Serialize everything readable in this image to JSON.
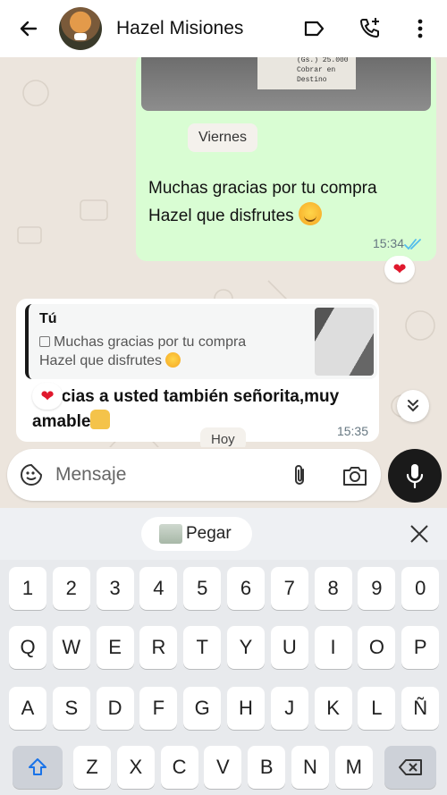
{
  "header": {
    "contact_name": "Hazel Misiones"
  },
  "chat": {
    "date_chip_top": "Viernes",
    "receipt_line1": "(Gs.) 25.000",
    "receipt_line2": "Cobrar en Destino",
    "outgoing": {
      "text_line1": "Muchas gracias por tu compra",
      "text_line2": "Hazel que disfrutes",
      "time": "15:34",
      "reaction": "❤"
    },
    "incoming": {
      "quote_author": "Tú",
      "quote_line1": "Muchas gracias por tu compra",
      "quote_line2": "Hazel que disfrutes",
      "text_line1": "Gracias a usted también señorita,muy",
      "text_line2": "amable",
      "time": "15:35",
      "reaction": "❤"
    },
    "date_chip_today": "Hoy"
  },
  "input": {
    "placeholder": "Mensaje"
  },
  "keyboard": {
    "paste_label": "Pegar",
    "row_numbers": [
      "1",
      "2",
      "3",
      "4",
      "5",
      "6",
      "7",
      "8",
      "9",
      "0"
    ],
    "row1": [
      "Q",
      "W",
      "E",
      "R",
      "T",
      "Y",
      "U",
      "I",
      "O",
      "P"
    ],
    "row2": [
      "A",
      "S",
      "D",
      "F",
      "G",
      "H",
      "J",
      "K",
      "L",
      "Ñ"
    ],
    "row3": [
      "Z",
      "X",
      "C",
      "V",
      "B",
      "N",
      "M"
    ]
  },
  "colors": {
    "outgoing_bubble": "#d9fdd3",
    "accent_ticks": "#53bdeb",
    "reaction_heart": "#e0182d",
    "mic_button": "#1a1a1a"
  }
}
